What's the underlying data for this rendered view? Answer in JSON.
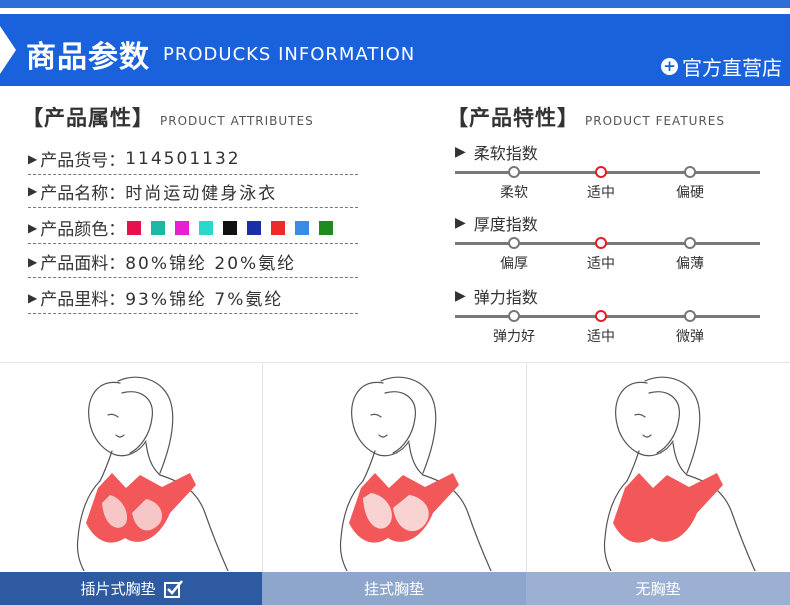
{
  "header": {
    "title": "商品参数",
    "subtitle": "PRODUCKS INFORMATION",
    "shop_label": "官方直营店"
  },
  "attributes": {
    "heading_cn": "【产品属性】",
    "heading_en": "PRODUCT ATTRIBUTES",
    "rows": [
      {
        "label": "产品货号：",
        "value": "114501132"
      },
      {
        "label": "产品名称：",
        "value": "时尚运动健身泳衣"
      },
      {
        "label": "产品颜色：",
        "value": ""
      },
      {
        "label": "产品面料：",
        "value": "80%锦纶  20%氨纶"
      },
      {
        "label": "产品里料：",
        "value": "93%锦纶  7%氨纶"
      }
    ],
    "colors": [
      "#e8104c",
      "#1cb8a2",
      "#e81ed2",
      "#2bd8cc",
      "#111111",
      "#1a2ea8",
      "#ee2a2a",
      "#3a8ae8",
      "#1f8a1f"
    ]
  },
  "features": {
    "heading_cn": "【产品特性】",
    "heading_en": "PRODUCT FEATURES",
    "items": [
      {
        "title": "柔软指数",
        "options": [
          "柔软",
          "适中",
          "偏硬"
        ],
        "selected": 1
      },
      {
        "title": "厚度指数",
        "options": [
          "偏厚",
          "适中",
          "偏薄"
        ],
        "selected": 1
      },
      {
        "title": "弹力指数",
        "options": [
          "弹力好",
          "适中",
          "微弹"
        ],
        "selected": 1
      }
    ]
  },
  "pad_types": {
    "tabs": [
      "插片式胸垫",
      "挂式胸垫",
      "无胸垫"
    ],
    "selected": 0
  },
  "colors": {
    "banner": "#1a62dc",
    "active_knob": "#e01e2a",
    "bra": "#f2585a"
  }
}
